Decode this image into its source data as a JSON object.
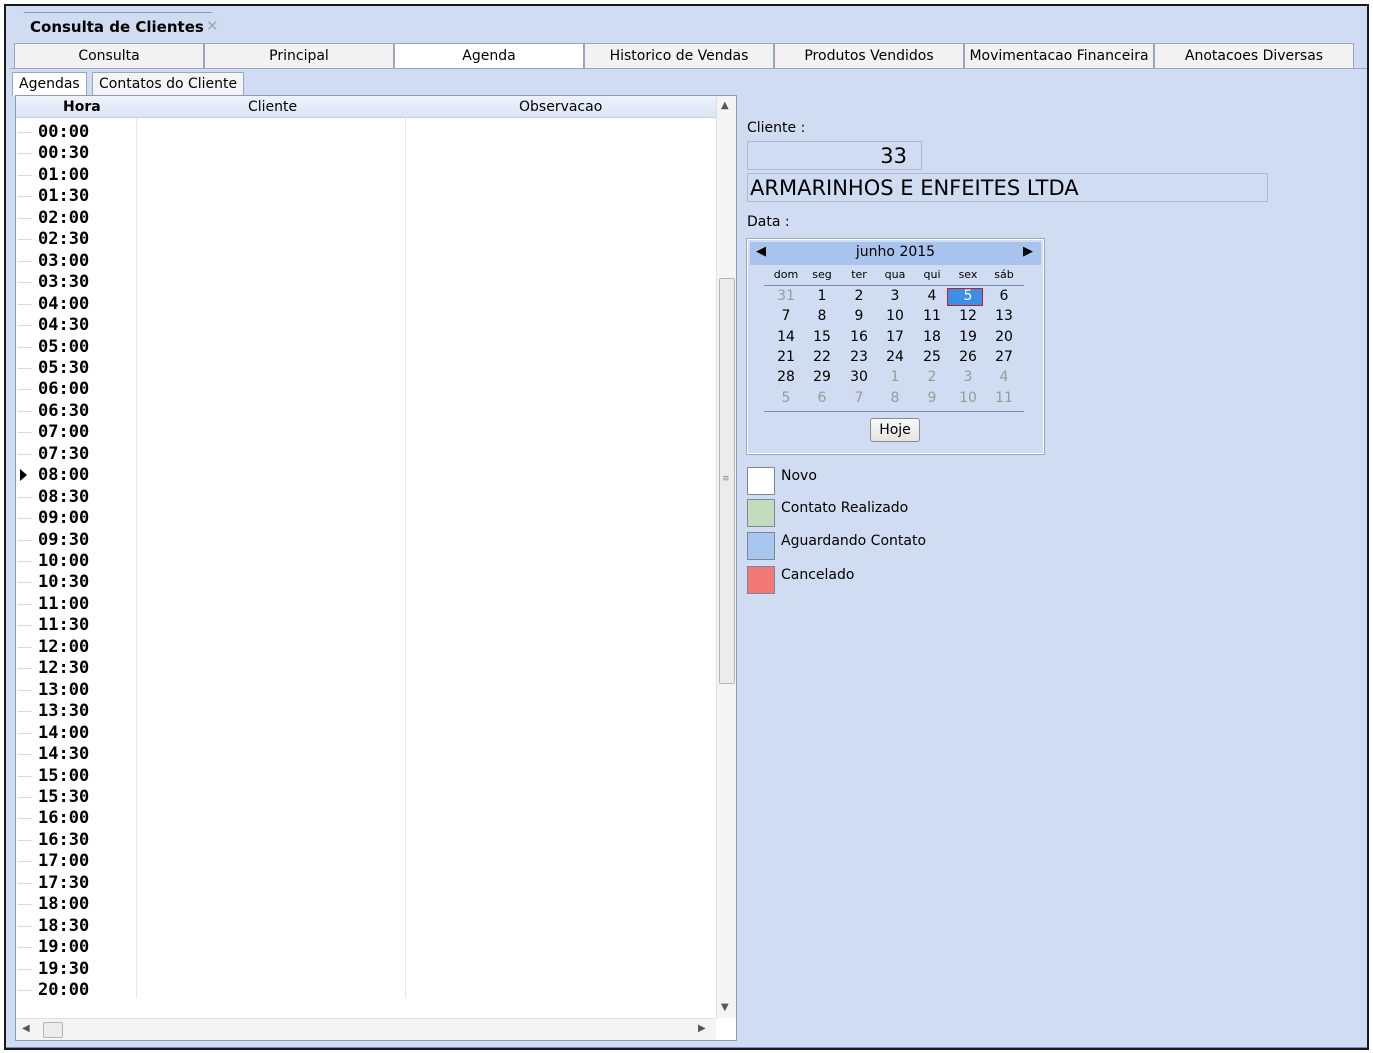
{
  "document_tab": {
    "title": "Consulta de Clientes",
    "close": "✕"
  },
  "tabs": [
    {
      "label": "Consulta"
    },
    {
      "label": "Principal"
    },
    {
      "label": "Agenda"
    },
    {
      "label": "Historico de Vendas"
    },
    {
      "label": "Produtos Vendidos"
    },
    {
      "label": "Movimentacao Financeira"
    },
    {
      "label": "Anotacoes Diversas"
    }
  ],
  "active_tab": "Agenda",
  "subtabs": [
    {
      "label": "Agendas"
    },
    {
      "label": "Contatos do Cliente"
    }
  ],
  "active_subtab": "Agendas",
  "grid": {
    "columns": [
      "Hora",
      "Cliente",
      "Observacao"
    ],
    "current_row": "08:00",
    "rows": [
      "00:00",
      "00:30",
      "01:00",
      "01:30",
      "02:00",
      "02:30",
      "03:00",
      "03:30",
      "04:00",
      "04:30",
      "05:00",
      "05:30",
      "06:00",
      "06:30",
      "07:00",
      "07:30",
      "08:00",
      "08:30",
      "09:00",
      "09:30",
      "10:00",
      "10:30",
      "11:00",
      "11:30",
      "12:00",
      "12:30",
      "13:00",
      "13:30",
      "14:00",
      "14:30",
      "15:00",
      "15:30",
      "16:00",
      "16:30",
      "17:00",
      "17:30",
      "18:00",
      "18:30",
      "19:00",
      "19:30",
      "20:00"
    ]
  },
  "client": {
    "label": "Cliente :",
    "code": "33",
    "name": "ARMARINHOS E ENFEITES LTDA"
  },
  "date": {
    "label": "Data :"
  },
  "calendar": {
    "month": "junho 2015",
    "prev_icon": "◀",
    "next_icon": "▶",
    "weekdays": [
      "dom",
      "seg",
      "ter",
      "qua",
      "qui",
      "sex",
      "sáb"
    ],
    "weeks": [
      [
        {
          "d": "31",
          "o": true
        },
        {
          "d": "1"
        },
        {
          "d": "2"
        },
        {
          "d": "3"
        },
        {
          "d": "4"
        },
        {
          "d": "5"
        },
        {
          "d": "6"
        }
      ],
      [
        {
          "d": "7"
        },
        {
          "d": "8"
        },
        {
          "d": "9"
        },
        {
          "d": "10"
        },
        {
          "d": "11"
        },
        {
          "d": "12"
        },
        {
          "d": "13"
        }
      ],
      [
        {
          "d": "14"
        },
        {
          "d": "15"
        },
        {
          "d": "16"
        },
        {
          "d": "17"
        },
        {
          "d": "18"
        },
        {
          "d": "19"
        },
        {
          "d": "20"
        }
      ],
      [
        {
          "d": "21"
        },
        {
          "d": "22"
        },
        {
          "d": "23"
        },
        {
          "d": "24"
        },
        {
          "d": "25"
        },
        {
          "d": "26"
        },
        {
          "d": "27"
        }
      ],
      [
        {
          "d": "28"
        },
        {
          "d": "29"
        },
        {
          "d": "30"
        },
        {
          "d": "1",
          "o": true
        },
        {
          "d": "2",
          "o": true
        },
        {
          "d": "3",
          "o": true
        },
        {
          "d": "4",
          "o": true
        }
      ],
      [
        {
          "d": "5",
          "o": true
        },
        {
          "d": "6",
          "o": true
        },
        {
          "d": "7",
          "o": true
        },
        {
          "d": "8",
          "o": true
        },
        {
          "d": "9",
          "o": true
        },
        {
          "d": "10",
          "o": true
        },
        {
          "d": "11",
          "o": true
        }
      ]
    ],
    "selected_day": "5",
    "today_button": "Hoje"
  },
  "legend": [
    {
      "label": "Novo",
      "color": "#ffffff"
    },
    {
      "label": "Contato Realizado",
      "color": "#c4dcbe"
    },
    {
      "label": "Aguardando Contato",
      "color": "#a9c6ee"
    },
    {
      "label": "Cancelado",
      "color": "#f27878"
    }
  ],
  "scroll_icons": {
    "up": "▲",
    "down": "▼",
    "left": "◀",
    "right": "▶",
    "grip": "≡"
  }
}
